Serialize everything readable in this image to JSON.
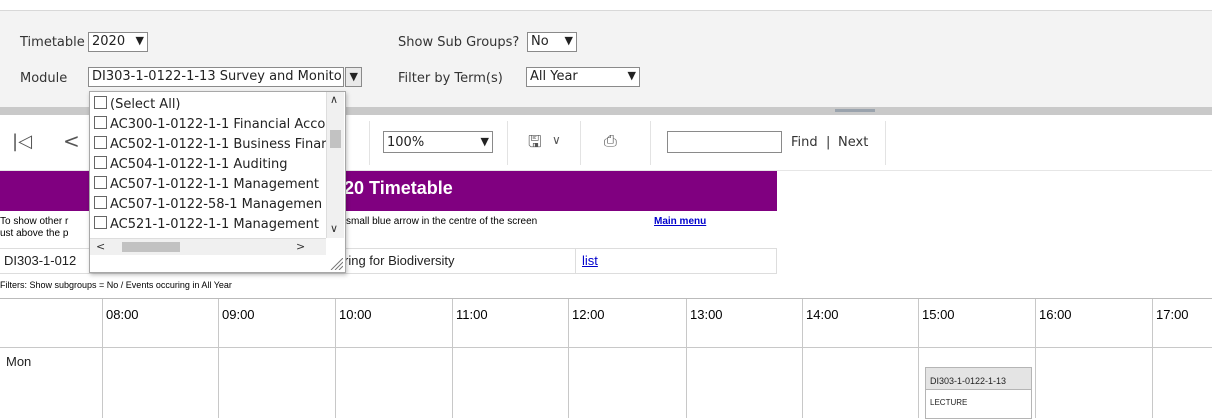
{
  "params": {
    "timetable_label": "Timetable",
    "timetable_value": "2020",
    "module_label": "Module",
    "module_value": "DI303-1-0122-1-13 Survey and Monito",
    "subgroups_label": "Show Sub Groups?",
    "subgroups_value": "No",
    "term_label": "Filter by Term(s)",
    "term_value": "All Year"
  },
  "dropdown": {
    "items": [
      "(Select All)",
      "AC300-1-0122-1-1 Financial Acco",
      "AC502-1-0122-1-1 Business Finar",
      "AC504-1-0122-1-1 Auditing",
      "AC507-1-0122-1-1 Management",
      "AC507-1-0122-58-1 Managemen",
      "AC521-1-0122-1-1 Management"
    ]
  },
  "toolbar": {
    "zoom": "100%",
    "find_label": "Find",
    "separator": "|",
    "next_label": "Next",
    "first_icon": "first-page-icon",
    "prev_icon": "previous-page-icon",
    "save_icon": "save-icon",
    "print_icon": "print-icon"
  },
  "report": {
    "title": "20 Timetable",
    "note_left_1": "To show other r",
    "note_left_2": "ust above the p",
    "note_right": "small blue arrow in the centre of the screen",
    "main_menu": "Main menu",
    "module_code": "DI303-1-012",
    "module_name": "ring for Biodiversity",
    "list_link": "list",
    "filters": "Filters: Show subgroups = No / Events occuring in All Year"
  },
  "timetable": {
    "hours": [
      "08:00",
      "09:00",
      "10:00",
      "11:00",
      "12:00",
      "13:00",
      "14:00",
      "15:00",
      "16:00",
      "17:00"
    ],
    "day": "Mon",
    "event": {
      "code": "DI303-1-0122-1-13",
      "type": "LECTURE"
    }
  },
  "colors": {
    "banner": "#800080",
    "link": "#0000cc"
  }
}
